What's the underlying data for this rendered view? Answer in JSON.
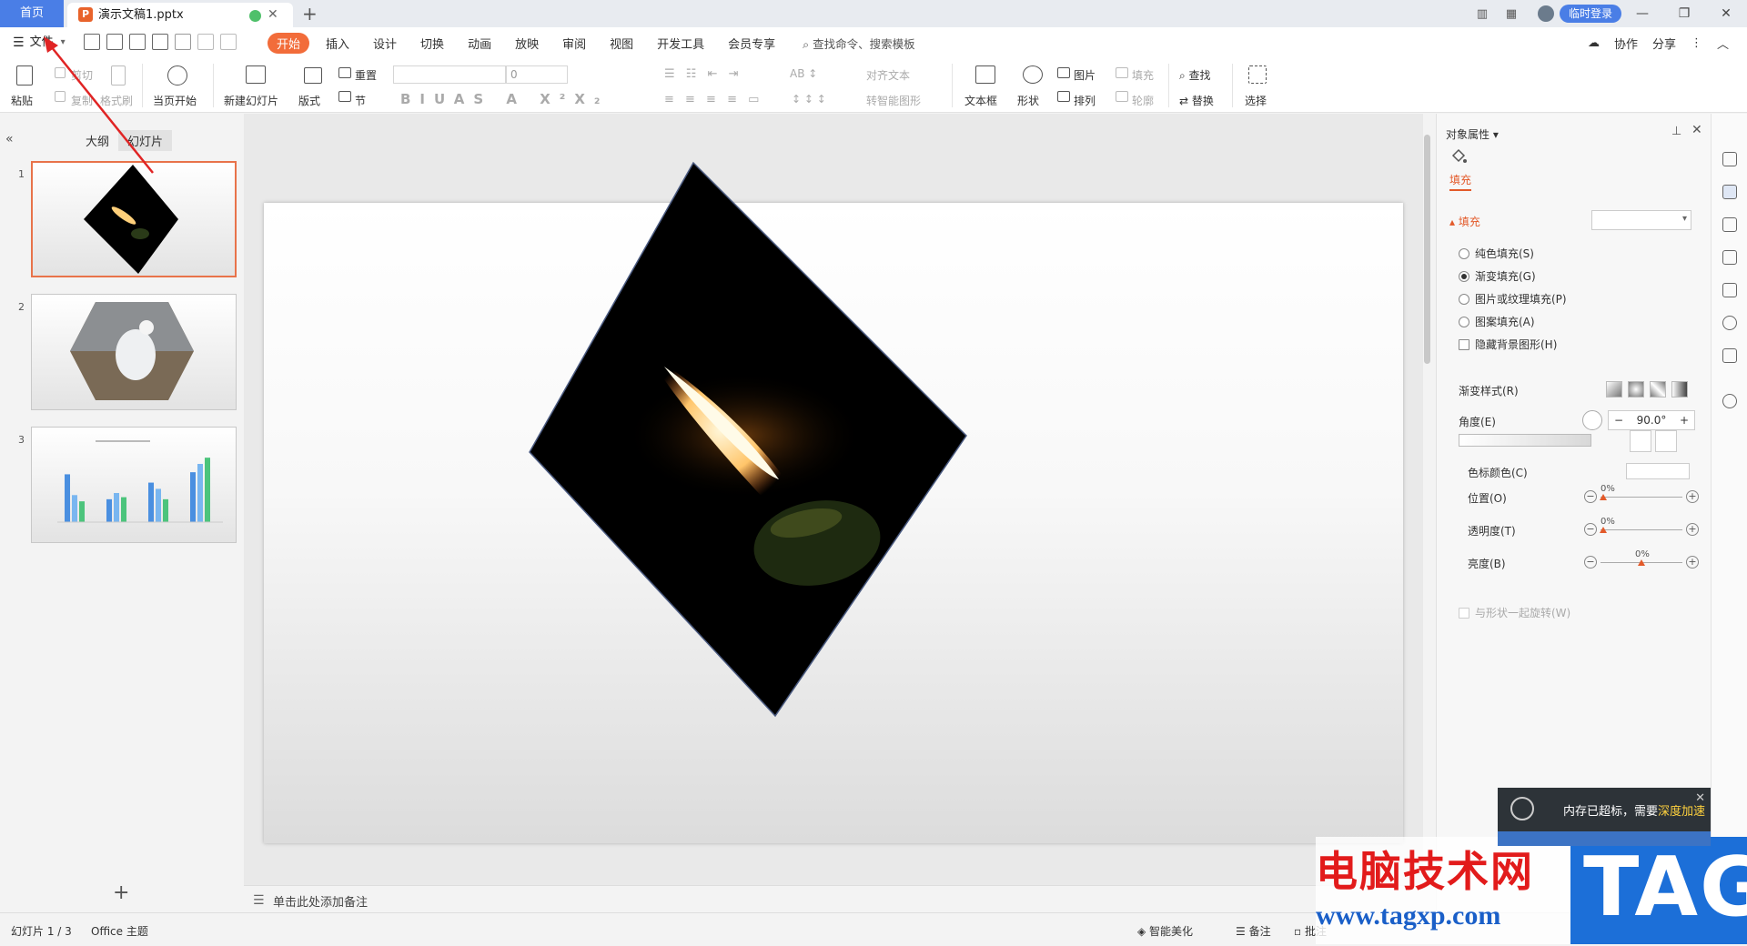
{
  "titlebar": {
    "home_tab": "首页",
    "doc_tab": "演示文稿1.pptx",
    "login": "临时登录"
  },
  "menubar": {
    "file": "文件",
    "items": [
      "开始",
      "插入",
      "设计",
      "切换",
      "动画",
      "放映",
      "审阅",
      "视图",
      "开发工具",
      "会员专享"
    ],
    "active_index": 0,
    "search": "查找命令、搜索模板",
    "collab": "协作",
    "share": "分享"
  },
  "ribbon": {
    "paste": "粘贴",
    "cut": "剪切",
    "copy": "复制",
    "format_painter": "格式刷",
    "start_from_current": "当页开始",
    "new_slide": "新建幻灯片",
    "layout": "版式",
    "section": "节",
    "reset": "重置",
    "font_size": "0",
    "align_text": "对齐文本",
    "smartart": "转智能图形",
    "textbox": "文本框",
    "shape": "形状",
    "picture": "图片",
    "arrange": "排列",
    "fill": "填充",
    "outline": "轮廓",
    "find": "查找",
    "replace": "替换",
    "select": "选择"
  },
  "leftpanel": {
    "tabs": [
      "大纲",
      "幻灯片"
    ],
    "active_tab": 1,
    "slides": [
      "1",
      "2",
      "3"
    ],
    "selected": 0
  },
  "notes": {
    "placeholder": "单击此处添加备注"
  },
  "rightpanel": {
    "title": "对象属性",
    "fill_tab": "填充",
    "section": "填充",
    "options": [
      "纯色填充(S)",
      "渐变填充(G)",
      "图片或纹理填充(P)",
      "图案填充(A)"
    ],
    "selected_option": 1,
    "hide_bg": "隐藏背景图形(H)",
    "gradient_style": "渐变样式(R)",
    "angle_label": "角度(E)",
    "angle_value": "90.0°",
    "stop_color": "色标颜色(C)",
    "position": "位置(O)",
    "position_value": "0%",
    "transparency": "透明度(T)",
    "transparency_value": "0%",
    "brightness": "亮度(B)",
    "brightness_value": "0%",
    "rotate_with_shape": "与形状一起旋转(W)"
  },
  "statusbar": {
    "slide_info": "幻灯片 1 / 3",
    "theme": "Office 主题",
    "beautify": "智能美化",
    "notes": "备注",
    "comments": "批注"
  },
  "popup": {
    "msg": "内存已超标，需要",
    "highlight": "深度加速"
  },
  "watermark": {
    "cn": "电脑技术网",
    "url": "www.tagxp.com",
    "tag": "TAG"
  },
  "colors": {
    "accent": "#f26c3a",
    "home_tab": "#4a7ee6",
    "fill_accent": "#e35a2a"
  },
  "chart_thumb": {
    "type": "bar",
    "values_a": [
      46,
      22,
      38,
      48
    ],
    "values_b": [
      26,
      28,
      32,
      56
    ],
    "values_c": [
      20,
      24,
      22,
      62
    ]
  }
}
